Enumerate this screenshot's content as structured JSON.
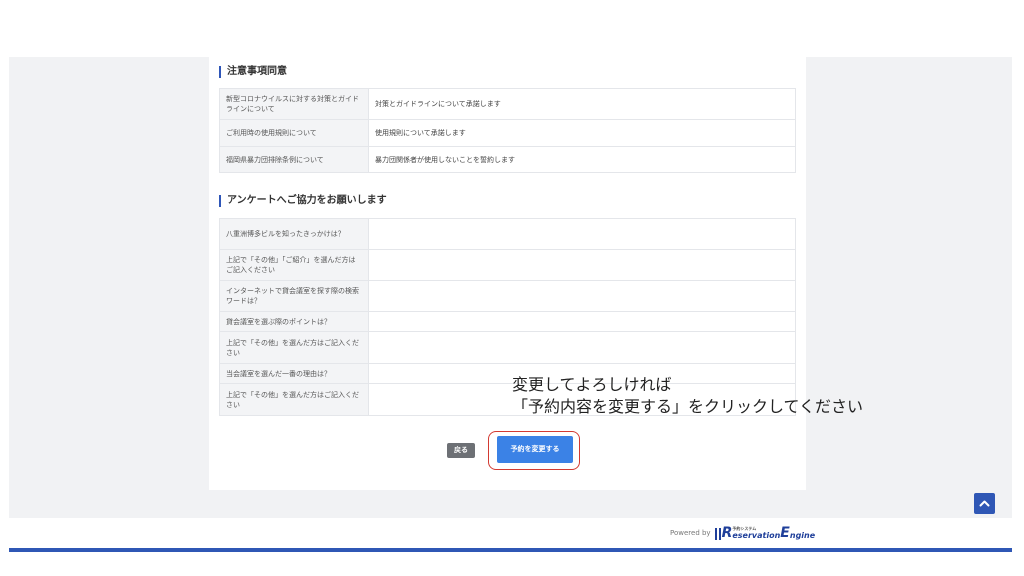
{
  "agreement": {
    "title": "注意事項同意",
    "rows": [
      {
        "label": "新型コロナウイルスに対する対策とガイドラインについて",
        "value": "対策とガイドラインについて承諾します"
      },
      {
        "label": "ご利用時の使用規則について",
        "value": "使用規則について承諾します"
      },
      {
        "label": "福岡県暴力団排除条例について",
        "value": "暴力団関係者が使用しないことを誓約します"
      }
    ]
  },
  "survey": {
    "title": "アンケートへご協力をお願いします",
    "rows": [
      {
        "label": "八重洲博多ビルを知ったきっかけは？",
        "value": ""
      },
      {
        "label": "上記で「その他」「ご紹介」を選んだ方はご記入ください",
        "value": ""
      },
      {
        "label": "インターネットで貸会議室を探す際の検索ワードは？",
        "value": ""
      },
      {
        "label": "貸会議室を選ぶ際のポイントは？",
        "value": ""
      },
      {
        "label": "上記で「その他」を選んだ方はご記入ください",
        "value": ""
      },
      {
        "label": "当会議室を選んだ一番の理由は？",
        "value": ""
      },
      {
        "label": "上記で「その他」を選んだ方はご記入ください",
        "value": ""
      }
    ]
  },
  "buttons": {
    "back": "戻る",
    "change": "予約を変更する"
  },
  "annotation": {
    "line1": "変更してよろしければ",
    "line2": "「予約内容を変更する」をクリックしてください"
  },
  "footer": {
    "powered_by": "Powered by",
    "logo_small_text": "予約システム",
    "logo_r": "R",
    "logo_eservation": "eservation",
    "logo_e": "E",
    "logo_ngine": "ngine"
  },
  "icons": {
    "scroll_top": "chevron-up-icon"
  },
  "colors": {
    "accent": "#2f57b5",
    "primary_button": "#3b82e6",
    "back_button": "#6d7075",
    "highlight": "#d33a32"
  }
}
